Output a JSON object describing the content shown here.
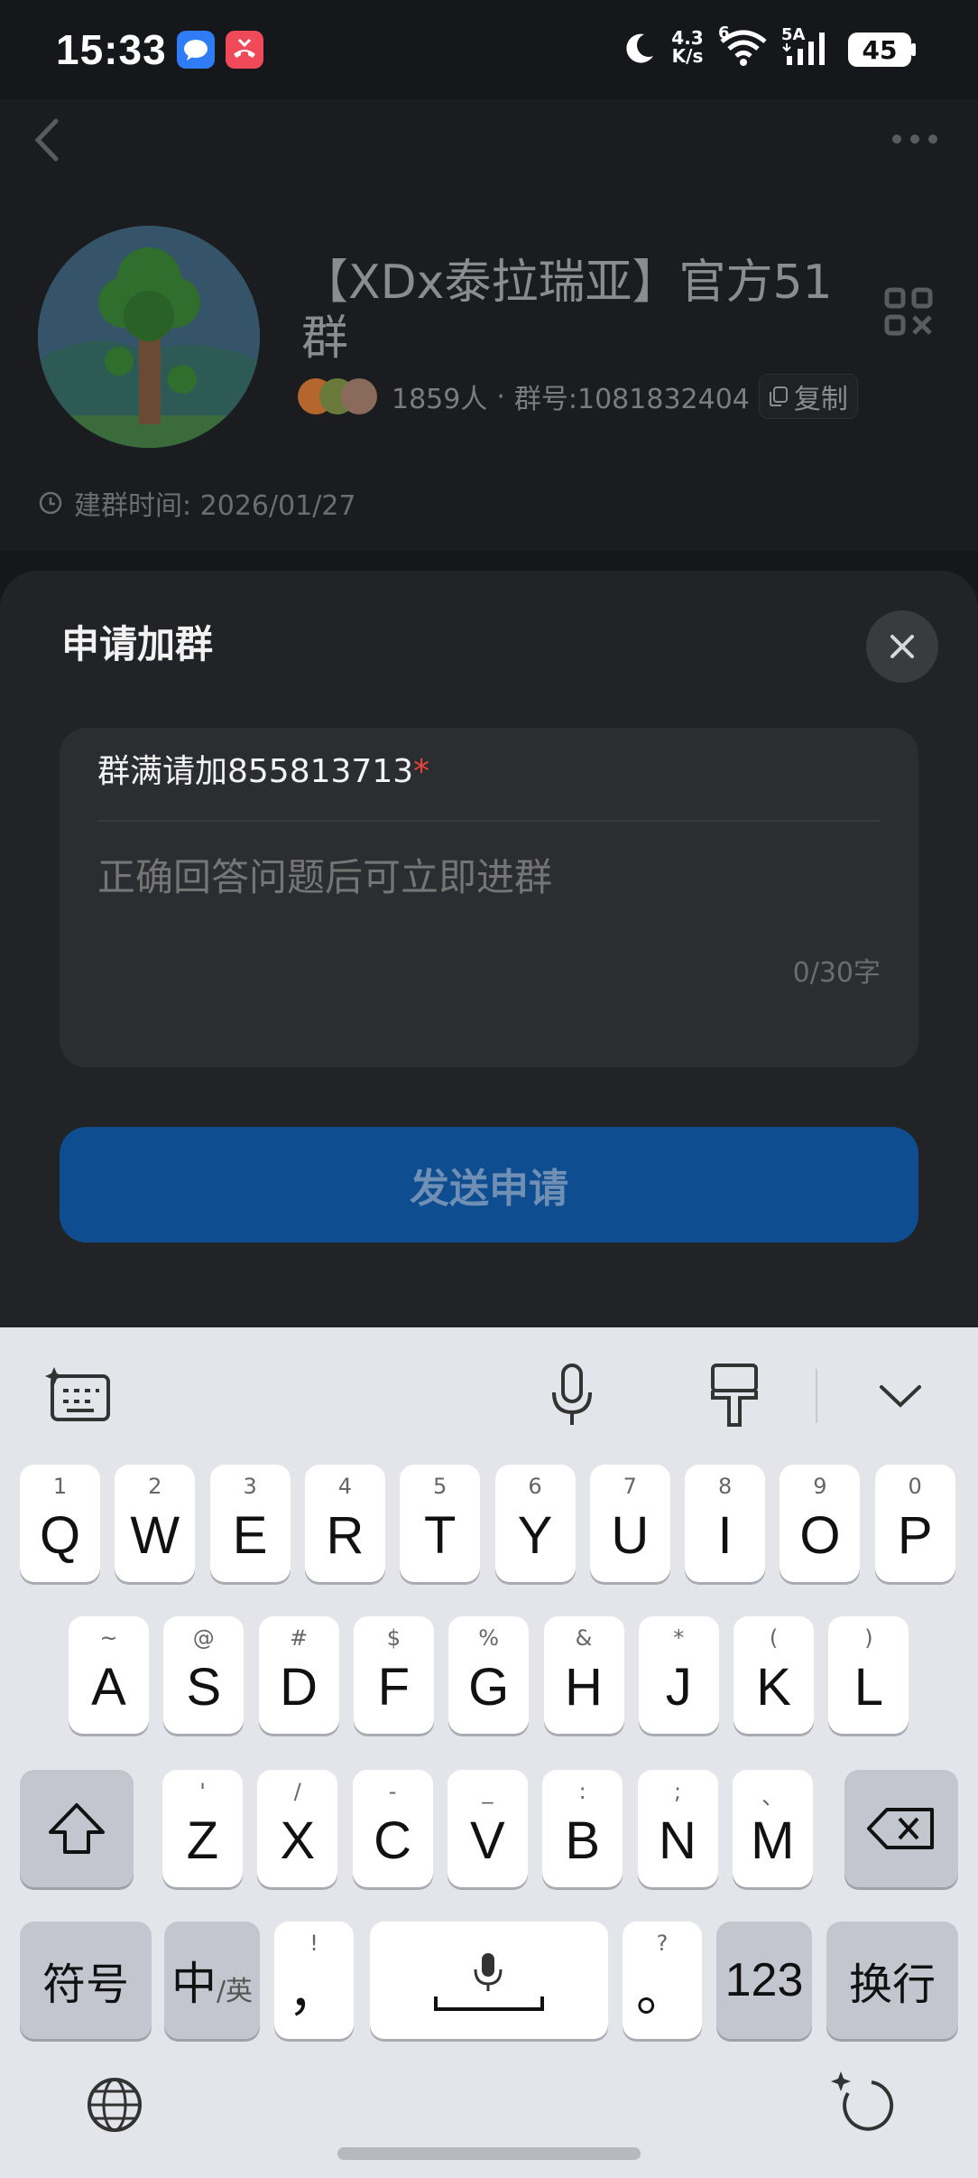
{
  "status": {
    "time": "15:33",
    "net_speed_top": "4.3",
    "net_speed_bottom": "K/s",
    "wifi_label": "6",
    "signal_label": "5A",
    "battery": "45"
  },
  "group": {
    "title": "【XDx泰拉瑞亚】官方51群",
    "members": "1859人",
    "separator": "·",
    "group_id": "群号:1081832404",
    "copy_label": "复制",
    "created": "建群时间: 2026/01/27"
  },
  "dialog": {
    "title": "申请加群",
    "question": "群满请加855813713",
    "required_mark": "*",
    "answer_placeholder": "正确回答问题后可立即进群",
    "counter": "0/30字",
    "send_label": "发送申请"
  },
  "keyboard": {
    "row1": [
      {
        "k": "Q",
        "s": "1"
      },
      {
        "k": "W",
        "s": "2"
      },
      {
        "k": "E",
        "s": "3"
      },
      {
        "k": "R",
        "s": "4"
      },
      {
        "k": "T",
        "s": "5"
      },
      {
        "k": "Y",
        "s": "6"
      },
      {
        "k": "U",
        "s": "7"
      },
      {
        "k": "I",
        "s": "8"
      },
      {
        "k": "O",
        "s": "9"
      },
      {
        "k": "P",
        "s": "0"
      }
    ],
    "row2": [
      {
        "k": "A",
        "s": "~"
      },
      {
        "k": "S",
        "s": "@"
      },
      {
        "k": "D",
        "s": "#"
      },
      {
        "k": "F",
        "s": "$"
      },
      {
        "k": "G",
        "s": "%"
      },
      {
        "k": "H",
        "s": "&"
      },
      {
        "k": "J",
        "s": "*"
      },
      {
        "k": "K",
        "s": "("
      },
      {
        "k": "L",
        "s": ")"
      }
    ],
    "row3": [
      {
        "k": "Z",
        "s": "'"
      },
      {
        "k": "X",
        "s": "/"
      },
      {
        "k": "C",
        "s": "-"
      },
      {
        "k": "V",
        "s": "_"
      },
      {
        "k": "B",
        "s": ":"
      },
      {
        "k": "N",
        "s": ";"
      },
      {
        "k": "M",
        "s": "、"
      }
    ],
    "symbols_label": "符号",
    "lang_main": "中",
    "lang_sub": "/英",
    "comma": "，",
    "comma_sub": "!",
    "period": "。",
    "period_sub": "?",
    "num_label": "123",
    "enter_label": "换行"
  },
  "colors": {
    "accent": "#0e4d8f",
    "required": "#e8453c"
  }
}
